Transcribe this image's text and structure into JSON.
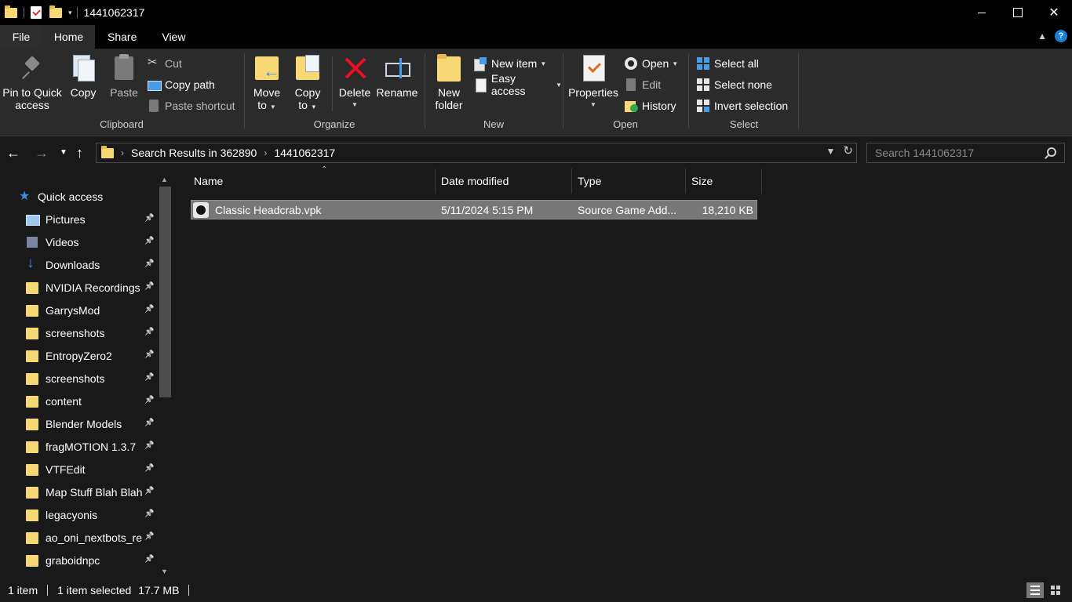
{
  "titlebar": {
    "title": "1441062317",
    "qa_dropdown": "▾",
    "min_label": "",
    "max_label": "",
    "close_label": "✕"
  },
  "tabs": [
    {
      "label": "File"
    },
    {
      "label": "Home"
    },
    {
      "label": "Share"
    },
    {
      "label": "View"
    }
  ],
  "ribbon": {
    "clipboard": {
      "label": "Clipboard",
      "pin_label_1": "Pin to Quick",
      "pin_label_2": "access",
      "copy": "Copy",
      "paste": "Paste",
      "cut": "Cut",
      "copy_path": "Copy path",
      "paste_shortcut": "Paste shortcut"
    },
    "organize": {
      "label": "Organize",
      "move_1": "Move",
      "move_2": "to",
      "copy_1": "Copy",
      "copy_2": "to",
      "delete": "Delete",
      "rename": "Rename"
    },
    "new": {
      "label": "New",
      "new_folder_1": "New",
      "new_folder_2": "folder",
      "new_item": "New item",
      "easy_access": "Easy access"
    },
    "open": {
      "label": "Open",
      "properties": "Properties",
      "open": "Open",
      "edit": "Edit",
      "history": "History"
    },
    "select": {
      "label": "Select",
      "select_all": "Select all",
      "select_none": "Select none",
      "invert_selection": "Invert selection"
    }
  },
  "address": {
    "crumbs": [
      "Search Results in 362890",
      "1441062317"
    ],
    "search_placeholder": "Search 1441062317"
  },
  "nav": {
    "quick_access": "Quick access",
    "items": [
      {
        "label": "Pictures",
        "icon": "pictures-icon"
      },
      {
        "label": "Videos",
        "icon": "videos-icon"
      },
      {
        "label": "Downloads",
        "icon": "downloads-icon"
      },
      {
        "label": "NVIDIA Recordings",
        "icon": "folder-icon"
      },
      {
        "label": "GarrysMod",
        "icon": "folder-icon"
      },
      {
        "label": "screenshots",
        "icon": "folder-icon"
      },
      {
        "label": "EntropyZero2",
        "icon": "folder-icon"
      },
      {
        "label": "screenshots",
        "icon": "folder-icon"
      },
      {
        "label": "content",
        "icon": "folder-icon"
      },
      {
        "label": "Blender Models",
        "icon": "folder-icon"
      },
      {
        "label": "fragMOTION 1.3.7",
        "icon": "folder-icon"
      },
      {
        "label": "VTFEdit",
        "icon": "folder-icon"
      },
      {
        "label": "Map Stuff Blah Blah",
        "icon": "folder-icon"
      },
      {
        "label": "legacyonis",
        "icon": "folder-icon"
      },
      {
        "label": "ao_oni_nextbots_re",
        "icon": "folder-icon"
      },
      {
        "label": "graboidnpc",
        "icon": "folder-icon"
      }
    ]
  },
  "columns": [
    "Name",
    "Date modified",
    "Type",
    "Size"
  ],
  "files": [
    {
      "name": "Classic Headcrab.vpk",
      "date": "5/11/2024 5:15 PM",
      "type": "Source Game Add...",
      "size": "18,210 KB"
    }
  ],
  "status": {
    "count": "1 item",
    "selected": "1 item selected",
    "size": "17.7 MB"
  },
  "colors": {
    "accent": "#3b8be0",
    "folder": "#f8d775",
    "delete": "#e81123",
    "selection": "#777777"
  }
}
